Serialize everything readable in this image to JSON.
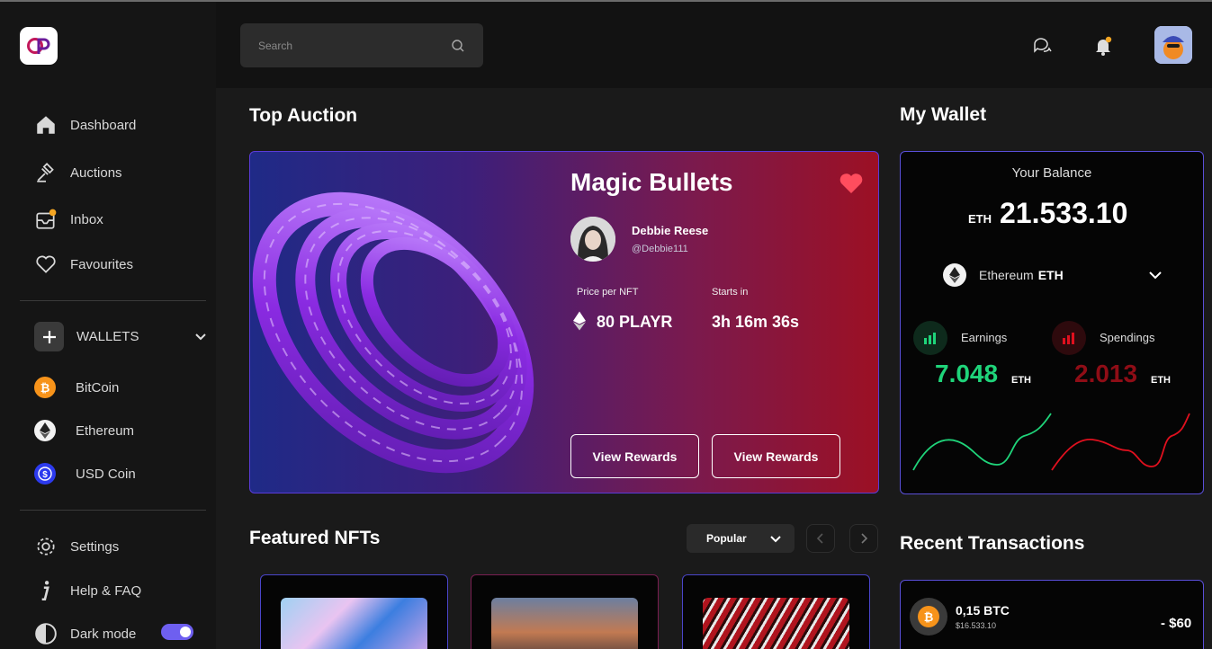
{
  "brand": {
    "logo_text": "CP"
  },
  "header": {
    "search_placeholder": "Search"
  },
  "sidebar": {
    "nav": [
      {
        "label": "Dashboard",
        "icon": "home-icon"
      },
      {
        "label": "Auctions",
        "icon": "gavel-icon"
      },
      {
        "label": "Inbox",
        "icon": "inbox-icon"
      },
      {
        "label": "Favourites",
        "icon": "heart-icon"
      }
    ],
    "wallets_label": "WALLETS",
    "coins": [
      {
        "label": "BitCoin",
        "icon": "bitcoin-icon",
        "color": "#f7931a"
      },
      {
        "label": "Ethereum",
        "icon": "ethereum-icon",
        "color": "#ffffff"
      },
      {
        "label": "USD Coin",
        "icon": "usdc-icon",
        "color": "#2775ca"
      }
    ],
    "footer": [
      {
        "label": "Settings",
        "icon": "gear-icon"
      },
      {
        "label": "Help & FAQ",
        "icon": "info-icon"
      },
      {
        "label": "Dark mode",
        "icon": "half-moon-icon"
      }
    ],
    "dark_mode_on": true
  },
  "auction": {
    "section_title": "Top Auction",
    "title": "Magic Bullets",
    "creator_name": "Debbie Reese",
    "creator_handle": "@Debbie111",
    "price_label": "Price per NFT",
    "price_value": "80 PLAYR",
    "starts_label": "Starts in",
    "starts_value": "3h 16m 36s",
    "button_1": "View Rewards",
    "button_2": "View Rewards"
  },
  "wallet": {
    "section_title": "My Wallet",
    "balance_label": "Your Balance",
    "balance_unit": "ETH",
    "balance_value": "21.533.10",
    "currency_name": "Ethereum",
    "currency_code": "ETH",
    "earnings_label": "Earnings",
    "earnings_value": "7.048",
    "earnings_unit": "ETH",
    "spendings_label": "Spendings",
    "spendings_value": "2.013",
    "spendings_unit": "ETH",
    "colors": {
      "earnings": "#1fd47a",
      "spendings": "#e0101e"
    }
  },
  "featured": {
    "section_title": "Featured NFTs",
    "sort_label": "Popular"
  },
  "transactions": {
    "section_title": "Recent Transactions",
    "items": [
      {
        "amount": "0,15 BTC",
        "sub": "$16.533.10",
        "delta": "- $60"
      }
    ]
  }
}
